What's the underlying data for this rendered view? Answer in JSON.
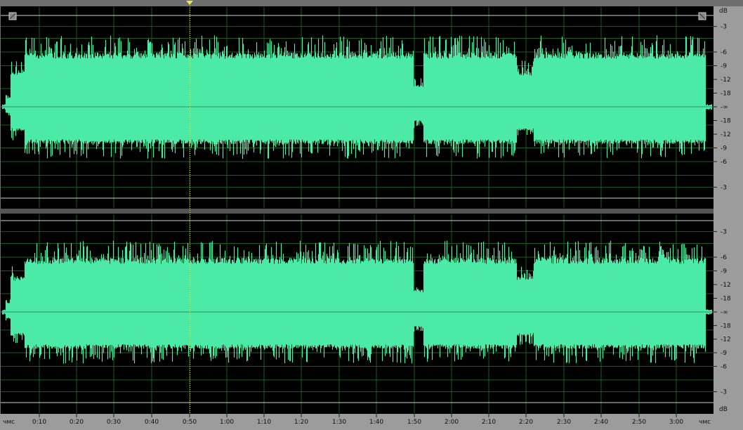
{
  "app": {
    "accent": "#4beaa6",
    "background": "#000000",
    "grid_color": "#1f5a1f",
    "cursor_color": "#e8e83a"
  },
  "channels": [
    {
      "name": "top",
      "db_labels": [
        "-3",
        "-6",
        "-9",
        "-12",
        "-18",
        "-∞",
        "-18",
        "-12",
        "-9",
        "-6",
        "-3"
      ]
    },
    {
      "name": "bottom",
      "db_labels": [
        "-3",
        "-6",
        "-9",
        "-12",
        "-18",
        "-∞",
        "-18",
        "-12",
        "-9",
        "-6",
        "-3"
      ]
    }
  ],
  "db_unit_top": "dB",
  "db_unit_bottom": "dB",
  "timeline": {
    "unit": "чмс",
    "unit_right": "чмс",
    "labels": [
      "0:10",
      "0:20",
      "0:30",
      "0:40",
      "0:50",
      "1:00",
      "1:10",
      "1:20",
      "1:30",
      "1:40",
      "1:50",
      "2:00",
      "2:10",
      "2:20",
      "2:30",
      "2:40",
      "2:50",
      "3:00"
    ]
  },
  "playhead_time": "0:50",
  "icons": {
    "playhead": "triangle-down-icon",
    "scroll_left": "scroll-handle-icon",
    "scroll_right": "scroll-handle-icon"
  }
}
